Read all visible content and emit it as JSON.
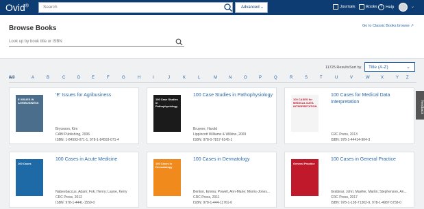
{
  "header": {
    "logo": "Ovid",
    "logo_mark": "®",
    "search_placeholder": "Search",
    "advanced_label": "Advanced",
    "nav": [
      {
        "label": "Journals"
      },
      {
        "label": "Books"
      },
      {
        "label": "Help"
      }
    ]
  },
  "browse": {
    "title": "Browse Books",
    "classic_link": "Go to Classic Books browse",
    "lookup_placeholder": "Look up by book title or ISBN"
  },
  "results": {
    "count": "11725 Results",
    "sort_label": "Sort by",
    "sort_value": "Title (A-Z)"
  },
  "alphabet": [
    "All",
    "A",
    "B",
    "C",
    "D",
    "E",
    "F",
    "G",
    "H",
    "I",
    "J",
    "K",
    "L",
    "M",
    "N",
    "O",
    "P",
    "Q",
    "R",
    "S",
    "T",
    "U",
    "V",
    "W",
    "X",
    "Y",
    "Z",
    "0-9"
  ],
  "books": [
    {
      "title": "'E' Issues for Agribusiness",
      "authors": "Bryceson, Kim",
      "publisher": "CABI Publishing, 2006",
      "isbn": "ISBN: 1-84593-071-1, 978-1-84593-071-4",
      "cover_color": "#4b6e8c",
      "cover_text": "E ISSUES IN AGRIBUSINESS"
    },
    {
      "title": "100 Case Studies in Pathophysiology",
      "authors": "Bruyere, Harold",
      "publisher": "Lippincott Williams & Wilkins, 2009",
      "isbn": "ISBN: 978-0-7817-6145-1",
      "cover_color": "#1b1b1b",
      "cover_text": "100 Case Studies in Pathophysiology"
    },
    {
      "title": "100 Cases for Medical Data Interpretation",
      "authors": "",
      "publisher": "CRC Press, 2013",
      "isbn": "ISBN: 978-1-44414-904-3",
      "cover_color": "#f4f4f4",
      "cover_text": "100 CASES for MEDICAL DATA INTERPRETATION"
    },
    {
      "title": "100 Cases in Acute Medicine",
      "authors": "Nabeebaccus, Adam; Fok, Henry; Layne, Kerry",
      "publisher": "CRC Press, 2012",
      "isbn": "ISBN: 978-1-4441-1559-0",
      "cover_color": "#1e6aa6",
      "cover_text": "100 Cases"
    },
    {
      "title": "100 Cases in Dermatology",
      "authors": "Benton, Emma; Powell, Ann-Marie; Morris-Jones...",
      "publisher": "CRC Press, 2011",
      "isbn": "ISBN: 978-1-444-11761-6",
      "cover_color": "#f08a1c",
      "cover_text": "100 Cases in Dermatology"
    },
    {
      "title": "100 Cases in General Practice",
      "authors": "Grabinar, John; Mueller, Martin; Stephenson, An...",
      "publisher": "CRC Press, 2017",
      "isbn": "ISBN: 978-1-138-71302-9, 978-1-4987-5758-0",
      "cover_color": "#c0192b",
      "cover_text": "General Practice"
    }
  ],
  "feedback_label": "feedback",
  "colors": {
    "header_bg": "#0d3c72",
    "link": "#2a67a8",
    "page_bg": "#f0f1f3"
  }
}
